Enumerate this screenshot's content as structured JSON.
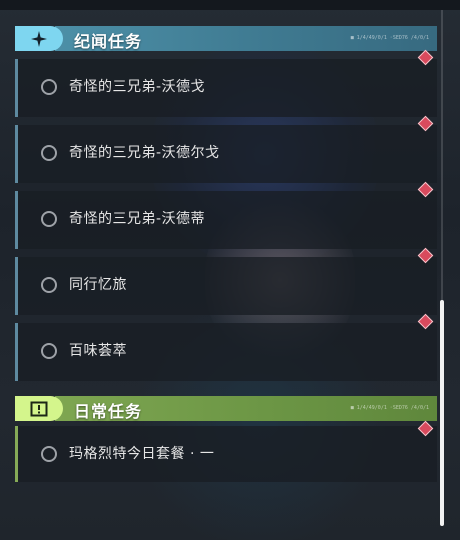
{
  "sections": {
    "journey": {
      "title": "纪闻任务",
      "tag": "■ 1/4/49/0/1 ◦SED76 /4/0/1",
      "icon": "four-point-star-icon",
      "color": "#7ed6f0",
      "quests": [
        {
          "label": "奇怪的三兄弟-沃德戈"
        },
        {
          "label": "奇怪的三兄弟-沃德尔戈"
        },
        {
          "label": "奇怪的三兄弟-沃德蒂"
        },
        {
          "label": "同行忆旅"
        },
        {
          "label": "百味荟萃"
        }
      ]
    },
    "daily": {
      "title": "日常任务",
      "tag": "■ 1/4/49/0/1 ◦SED76 /4/0/1",
      "icon": "exclamation-box-icon",
      "color": "#d4f58c",
      "quests": [
        {
          "label": "玛格烈特今日套餐 · 一"
        }
      ]
    }
  },
  "icons": {
    "quest_status": "empty-circle-icon",
    "new_marker": "red-diamond-icon"
  },
  "colors": {
    "new_marker": "#d84a5d",
    "journey_accent": "#5e8aa0",
    "daily_accent": "#86aa57"
  }
}
